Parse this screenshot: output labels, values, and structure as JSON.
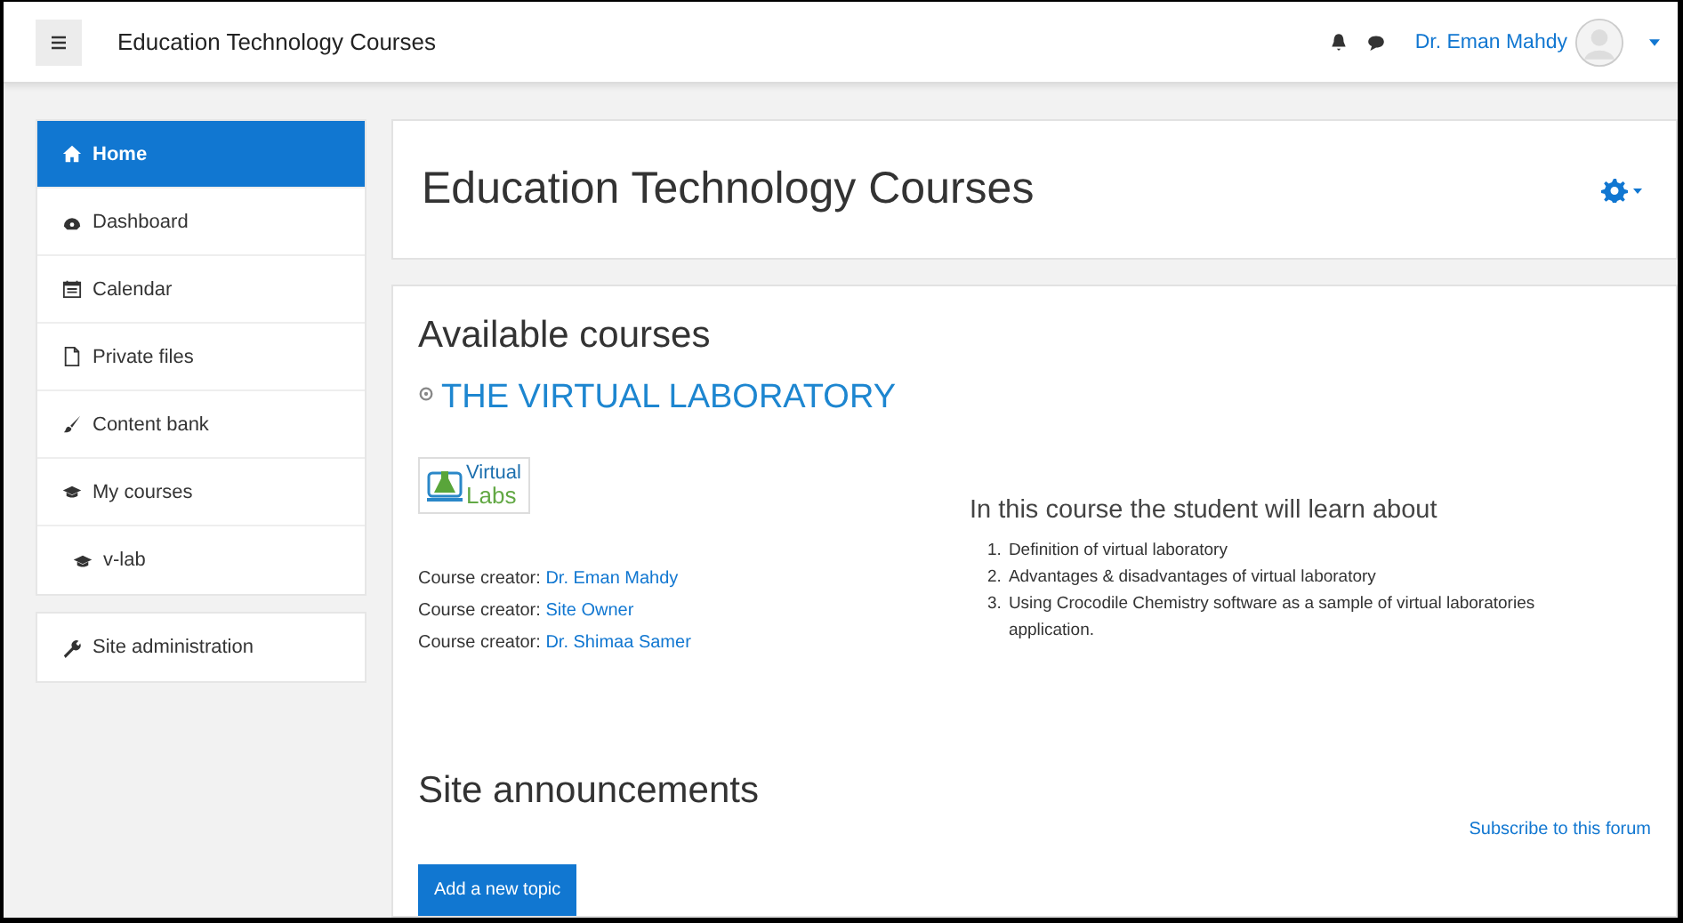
{
  "navbar": {
    "site_name": "Education Technology Courses",
    "user_name": "Dr. Eman Mahdy"
  },
  "sidebar": {
    "items": [
      {
        "label": "Home",
        "kind": "home",
        "selected": true
      },
      {
        "label": "Dashboard",
        "kind": "dashboard",
        "selected": false
      },
      {
        "label": "Calendar",
        "kind": "calendar",
        "selected": false
      },
      {
        "label": "Private files",
        "kind": "file",
        "selected": false
      },
      {
        "label": "Content bank",
        "kind": "brush",
        "selected": false
      },
      {
        "label": "My courses",
        "kind": "cap",
        "selected": false,
        "children": [
          {
            "label": "v-lab",
            "kind": "cap",
            "selected": false
          }
        ]
      }
    ],
    "admin_items": [
      {
        "label": "Site administration",
        "kind": "wrench",
        "selected": false
      }
    ]
  },
  "page_header": {
    "title": "Education Technology Courses"
  },
  "available_courses": {
    "heading": "Available courses",
    "course": {
      "name": "THE VIRTUAL LABORATORY",
      "logo": {
        "line_1": "Virtual",
        "line_2": "Labs"
      },
      "creators": [
        {
          "label": "Course creator:",
          "name": "Dr. Eman Mahdy"
        },
        {
          "label": "Course creator:",
          "name": "Site Owner"
        },
        {
          "label": "Course creator:",
          "name": "Dr. Shimaa Samer"
        }
      ],
      "summary_heading": "In this course the student will learn about",
      "summary_items": [
        {
          "number": "1.",
          "text": "Definition of virtual laboratory"
        },
        {
          "number": "2.",
          "text": "Advantages & disadvantages of  virtual laboratory"
        },
        {
          "number": "3.",
          "text": "Using Crocodile Chemistry software as a sample of virtual laboratories application."
        }
      ]
    }
  },
  "site_announcements": {
    "heading": "Site announcements",
    "subscribe_link": "Subscribe to this forum",
    "add_button": "Add a new topic"
  }
}
